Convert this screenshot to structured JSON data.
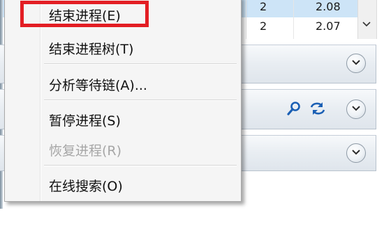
{
  "table": {
    "rows": [
      {
        "threads": "2",
        "cpu": "2.08",
        "selected": true
      },
      {
        "threads": "2",
        "cpu": "2.07",
        "selected": false
      }
    ]
  },
  "icons": {
    "scroll_down": "chevron-down-icon",
    "expand": "expand-chevron-icon",
    "search": "search-icon",
    "refresh": "refresh-icon"
  },
  "context_menu": {
    "items": [
      {
        "label": "结束进程(E)",
        "enabled": true,
        "highlighted": true
      },
      {
        "label": "结束进程树(T)",
        "enabled": true
      },
      {
        "label": "分析等待链(A)...",
        "enabled": true
      },
      {
        "label": "暂停进程(S)",
        "enabled": true
      },
      {
        "label": "恢复进程(R)",
        "enabled": false
      },
      {
        "label": "在线搜索(O)",
        "enabled": true
      }
    ]
  },
  "colors": {
    "highlight_border": "#e31e24",
    "selected_row": "#cde4f7",
    "disabled_text": "#a6a6a6",
    "accent_blue": "#1a5fb4"
  }
}
